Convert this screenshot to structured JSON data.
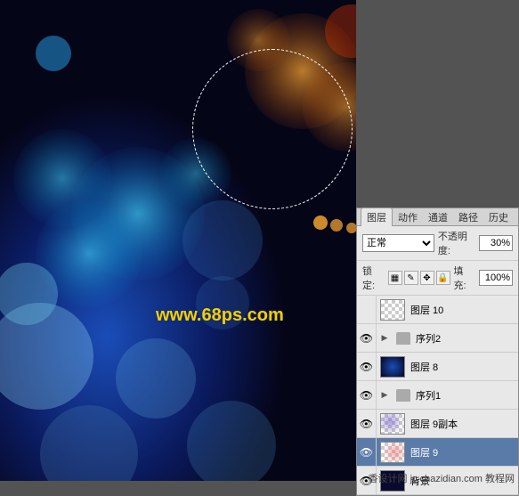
{
  "watermark": {
    "main": "www.68ps.com",
    "bottom": "香设计网 jc.chazidian.com 教程网"
  },
  "panel": {
    "tabs": {
      "layers": "图层",
      "actions": "动作",
      "channels": "通道",
      "paths": "路径",
      "history": "历史"
    },
    "blend_mode": "正常",
    "opacity_label": "不透明度:",
    "opacity_value": "30%",
    "lock_label": "锁定:",
    "fill_label": "填充:",
    "fill_value": "100%",
    "layers": {
      "l10": "图层 10",
      "seq2": "序列2",
      "l8": "图层 8",
      "seq1": "序列1",
      "l9copy": "图层 9副本",
      "l9": "图层 9",
      "bg": "背景"
    }
  }
}
